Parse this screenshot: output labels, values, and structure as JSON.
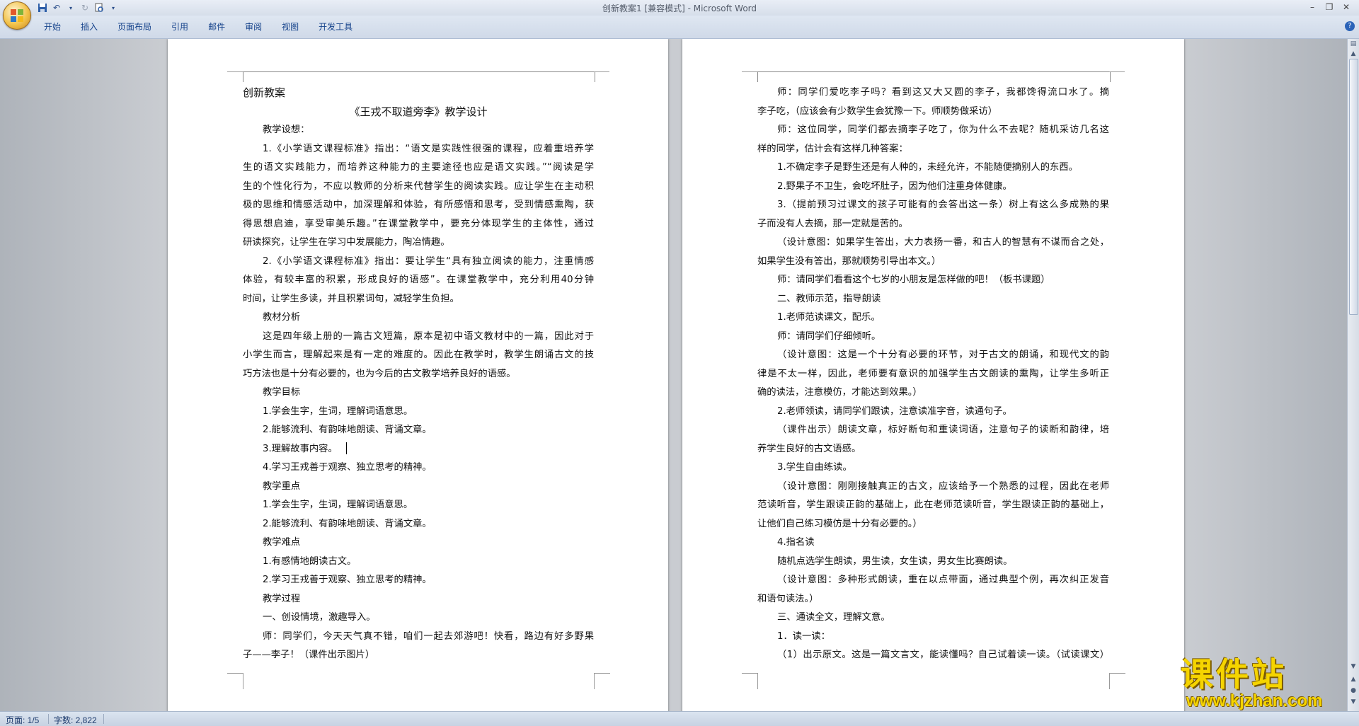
{
  "window": {
    "title": "创新教案1 [兼容模式] - Microsoft Word"
  },
  "quick_access": {
    "save_icon": "save-icon",
    "undo_icon": "undo-icon",
    "redo_icon": "redo-icon",
    "print_preview_icon": "print-preview-icon",
    "customize_icon": "dropdown-arrow-icon"
  },
  "ribbon": {
    "tabs": [
      "开始",
      "插入",
      "页面布局",
      "引用",
      "邮件",
      "审阅",
      "视图",
      "开发工具"
    ]
  },
  "page1": {
    "header_text": "创新教案",
    "title": "《王戎不取道旁李》教学设计",
    "lines": [
      "教学设想：",
      "1.《小学语文课程标准》指出：“语文是实践性很强的课程，应着重培养学",
      "生的语文实践能力，而培养这种能力的主要途径也应是语文实践。”“阅读是学",
      "生的个性化行为，不应以教师的分析来代替学生的阅读实践。应让学生在主动积",
      "极的思维和情感活动中，加深理解和体验，有所感悟和思考，受到情感熏陶，获",
      "得思想启迪，享受审美乐趣。”在课堂教学中，要充分体现学生的主体性，通过",
      "研读探究，让学生在学习中发展能力，陶冶情趣。",
      "2.《小学语文课程标准》指出：要让学生“具有独立阅读的能力，注重情感",
      "体验，有较丰富的积累，形成良好的语感”。在课堂教学中，充分利用40分钟",
      "时间，让学生多读，并且积累词句，减轻学生负担。",
      "教材分析",
      "这是四年级上册的一篇古文短篇，原本是初中语文教材中的一篇，因此对于",
      "小学生而言，理解起来是有一定的难度的。因此在教学时，教学生朗诵古文的技",
      "巧方法也是十分有必要的，也为今后的古文教学培养良好的语感。",
      "教学目标",
      "1.学会生字，生词，理解词语意思。",
      "2.能够流利、有韵味地朗读、背诵文章。",
      "3.理解故事内容。",
      "4.学习王戎善于观察、独立思考的精神。",
      "教学重点",
      "1.学会生字，生词，理解词语意思。",
      "2.能够流利、有韵味地朗读、背诵文章。",
      "教学难点",
      "1.有感情地朗读古文。",
      "2.学习王戎善于观察、独立思考的精神。",
      "教学过程",
      "一、创设情境，激趣导入。",
      "师：同学们，今天天气真不错，咱们一起去郊游吧！快看，路边有好多野果",
      "子——李子！（课件出示图片）"
    ]
  },
  "page2": {
    "lines": [
      "师：同学们爱吃李子吗？看到这又大又圆的李子，我都馋得流口水了。摘",
      "李子吃，（应该会有少数学生会犹豫一下。师顺势做采访）",
      "师：这位同学，同学们都去摘李子吃了，你为什么不去呢？随机采访几名这",
      "样的同学，估计会有这样几种答案：",
      "1.不确定李子是野生还是有人种的，未经允许，不能随便摘别人的东西。",
      "2.野果子不卫生，会吃坏肚子，因为他们注重身体健康。",
      "3.（提前预习过课文的孩子可能有的会答出这一条）树上有这么多成熟的果",
      "子而没有人去摘，那一定就是苦的。",
      "（设计意图：如果学生答出，大力表扬一番，和古人的智慧有不谋而合之处，",
      "如果学生没有答出，那就顺势引导出本文。）",
      "师：请同学们看看这个七岁的小朋友是怎样做的吧！（板书课题）",
      "二、教师示范，指导朗读",
      "1.老师范读课文，配乐。",
      "师：请同学们仔细倾听。",
      "（设计意图：这是一个十分有必要的环节，对于古文的朗诵，和现代文的韵",
      "律是不太一样，因此，老师要有意识的加强学生古文朗读的熏陶，让学生多听正",
      "确的读法，注意模仿，才能达到效果。）",
      "2.老师领读，请同学们跟读，注意读准字音，读通句子。",
      "（课件出示）朗读文章，标好断句和重读词语，注意句子的读断和韵律，培",
      "养学生良好的古文语感。",
      "3.学生自由练读。",
      "（设计意图：刚刚接触真正的古文，应该给予一个熟悉的过程，因此在老师",
      "范读听音，学生跟读正韵的基础上，此在老师范读听音，学生跟读正韵的基础上，",
      "让他们自己练习模仿是十分有必要的。）",
      "4.指名读",
      "随机点选学生朗读，男生读，女生读，男女生比赛朗读。",
      "（设计意图：多种形式朗读，重在以点带面，通过典型个例，再次纠正发音",
      "和语句读法。）",
      "三、通读全文，理解文意。",
      "1．读一读：",
      "（1）出示原文。这是一篇文言文，能读懂吗？自己试着读一读。（试读课文）"
    ]
  },
  "status": {
    "page": "页面: 1/5",
    "words": "字数: 2,822"
  },
  "watermark": {
    "big": "课件站",
    "small": "www.kjzhan.com"
  }
}
